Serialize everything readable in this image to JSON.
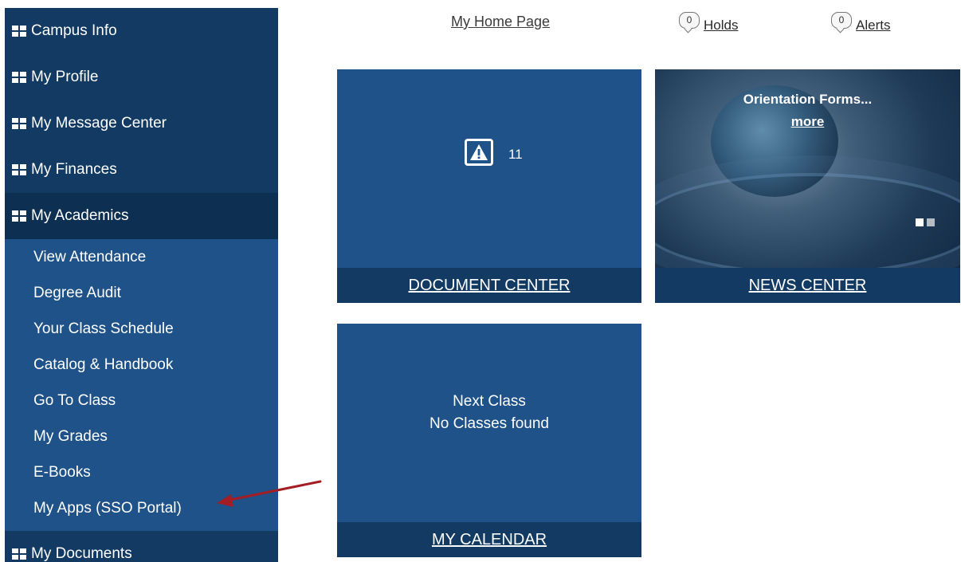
{
  "sidebar": {
    "sections_top": [
      {
        "label": "Campus Info"
      },
      {
        "label": "My Profile"
      },
      {
        "label": "My Message Center"
      },
      {
        "label": "My Finances"
      },
      {
        "label": "My Academics"
      }
    ],
    "academics_items": [
      {
        "label": "View Attendance"
      },
      {
        "label": "Degree Audit"
      },
      {
        "label": "Your Class Schedule"
      },
      {
        "label": "Catalog & Handbook"
      },
      {
        "label": "Go To Class"
      },
      {
        "label": "My Grades"
      },
      {
        "label": "E-Books"
      },
      {
        "label": "My Apps (SSO Portal)"
      }
    ],
    "sections_bottom": [
      {
        "label": "My Documents"
      }
    ]
  },
  "top_links": {
    "home": "My Home Page",
    "holds_count": "0",
    "holds": "Holds",
    "alerts_count": "0",
    "alerts": "Alerts"
  },
  "tiles": {
    "document_center": {
      "count": "11",
      "footer": "DOCUMENT CENTER"
    },
    "news_center": {
      "headline": "Orientation Forms...",
      "more": "more",
      "footer": "NEWS CENTER"
    },
    "my_calendar": {
      "line1": "Next Class",
      "line2": "No Classes found",
      "footer": "MY CALENDAR"
    }
  },
  "colors": {
    "sidebar_dark": "#123a63",
    "sidebar_sub": "#1e5288",
    "annotation_arrow": "#a31d24"
  }
}
